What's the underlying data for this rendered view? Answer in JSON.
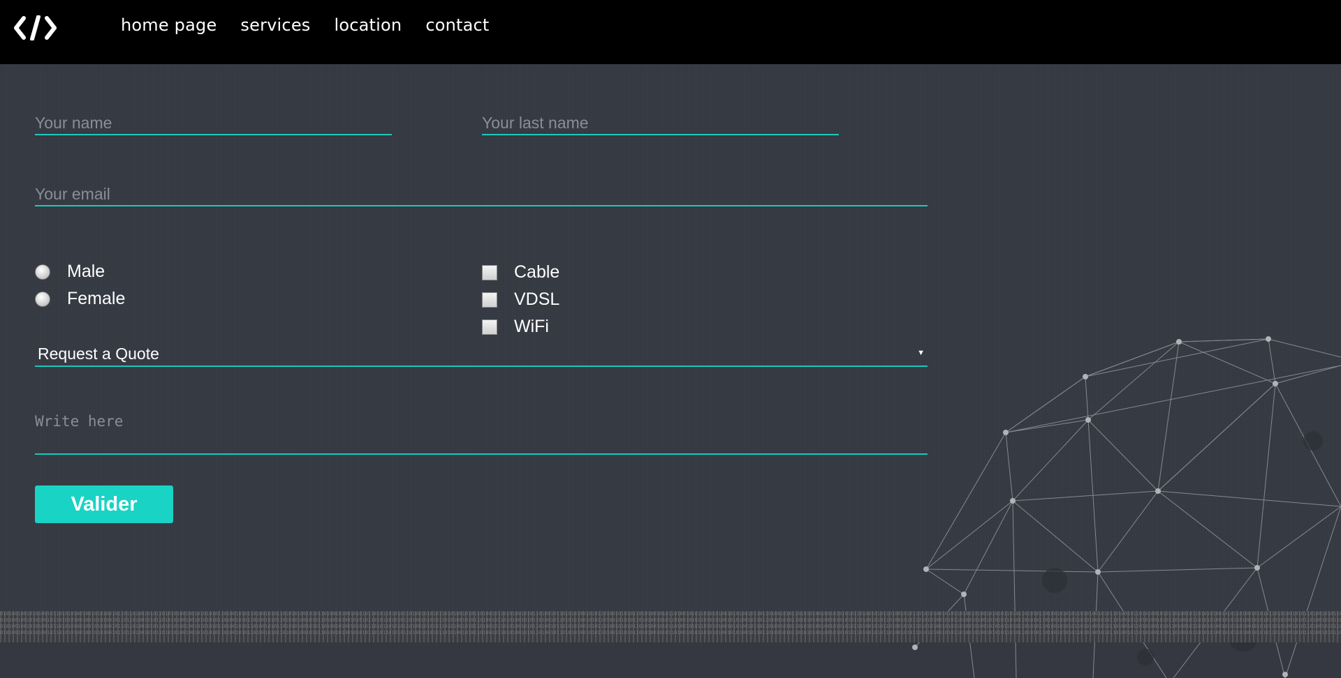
{
  "nav": {
    "logo_icon": "code-brackets-icon",
    "items": [
      "home page",
      "services",
      "location",
      "contact"
    ]
  },
  "form": {
    "first_name_placeholder": "Your name",
    "last_name_placeholder": "Your last name",
    "email_placeholder": "Your email",
    "gender": [
      "Male",
      "Female"
    ],
    "services": [
      "Cable",
      "VDSL",
      "WiFi"
    ],
    "select_value": "Request a Quote",
    "message_placeholder": "Write here",
    "submit_label": "Valider"
  },
  "colors": {
    "accent": "#19d3c5",
    "topbar": "#000000",
    "background": "#363a43"
  },
  "footer": {
    "binary_text": "010100100101010010110101010010010101001011011010010101101010100100101010101101001010110100101011010101001010110100101001010101101011010101101001010101101010010101101001011010100101011010010110101010010101101001010101101010010101101001010110101010010101001011011010010101101010100100101010101101001010110100101011010101001010110100101001010101101011010101101001010101101010010101101001011010100101011010010110101010010101101001010101101010010101101001010110101"
  }
}
